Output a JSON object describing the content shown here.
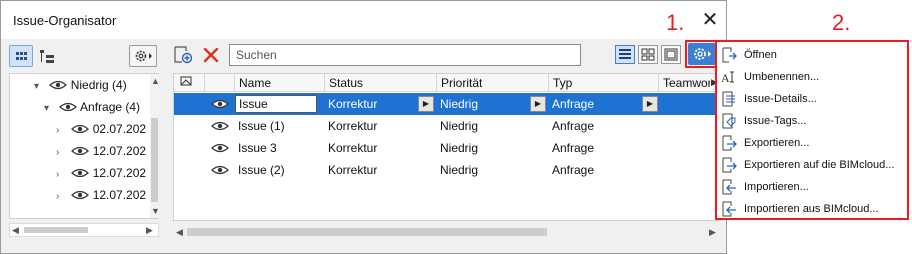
{
  "window": {
    "title": "Issue-Organisator",
    "close_glyph": "✕"
  },
  "annotations": {
    "one": "1.",
    "two": "2."
  },
  "tree": {
    "items": [
      {
        "label": "Niedrig (4)",
        "level": 0,
        "expanded": true
      },
      {
        "label": "Anfrage (4)",
        "level": 1,
        "expanded": true
      },
      {
        "label": "02.07.202",
        "level": 2,
        "expanded": false
      },
      {
        "label": "12.07.202",
        "level": 2,
        "expanded": false
      },
      {
        "label": "12.07.202",
        "level": 2,
        "expanded": false
      },
      {
        "label": "12.07.202",
        "level": 2,
        "expanded": false
      }
    ]
  },
  "search": {
    "placeholder": "Suchen"
  },
  "table": {
    "columns": [
      "Name",
      "Status",
      "Priorität",
      "Typ",
      "Teamwor"
    ],
    "rows": [
      {
        "name": "Issue",
        "status": "Korrektur",
        "priority": "Niedrig",
        "type": "Anfrage",
        "selected": true
      },
      {
        "name": "Issue (1)",
        "status": "Korrektur",
        "priority": "Niedrig",
        "type": "Anfrage",
        "selected": false
      },
      {
        "name": "Issue 3",
        "status": "Korrektur",
        "priority": "Niedrig",
        "type": "Anfrage",
        "selected": false
      },
      {
        "name": "Issue (2)",
        "status": "Korrektur",
        "priority": "Niedrig",
        "type": "Anfrage",
        "selected": false
      }
    ]
  },
  "menu": {
    "items": [
      {
        "label": "Öffnen",
        "icon": "open-icon"
      },
      {
        "label": "Umbenennen...",
        "icon": "rename-icon"
      },
      {
        "label": "Issue-Details...",
        "icon": "details-icon"
      },
      {
        "label": "Issue-Tags...",
        "icon": "tags-icon"
      },
      {
        "label": "Exportieren...",
        "icon": "export-icon"
      },
      {
        "label": "Exportieren auf die BIMcloud...",
        "icon": "export-cloud-icon"
      },
      {
        "label": "Importieren...",
        "icon": "import-icon"
      },
      {
        "label": "Importieren aus BIMcloud...",
        "icon": "import-cloud-icon"
      }
    ]
  },
  "colors": {
    "accent": "#1e73d2",
    "annotation": "#e81e25",
    "delete": "#e0301e"
  }
}
